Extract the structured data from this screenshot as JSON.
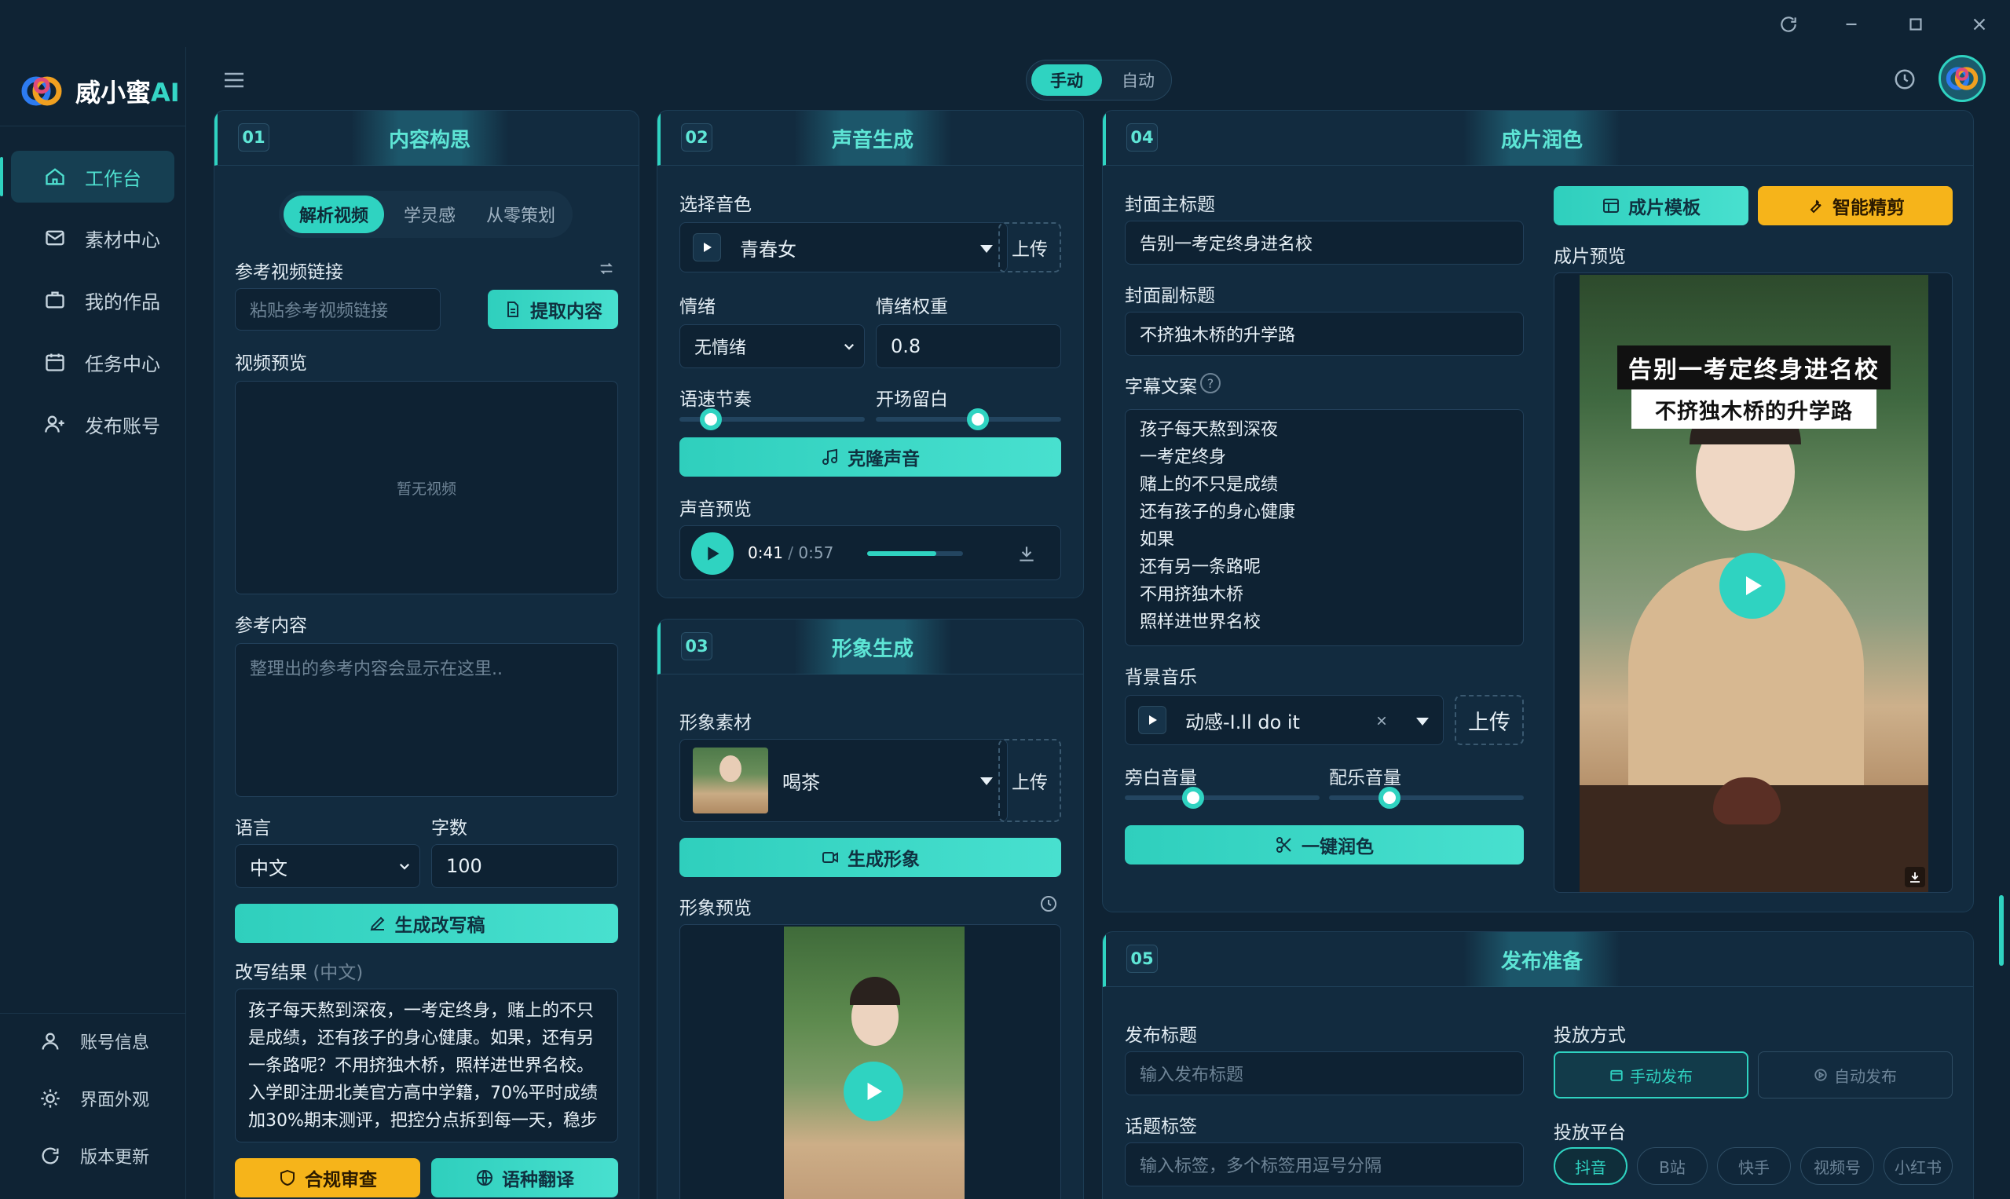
{
  "brand": {
    "name": "威小蜜",
    "suffix": "AI"
  },
  "mode_toggle": {
    "manual": "手动",
    "auto": "自动"
  },
  "sidebar": {
    "items": [
      {
        "label": "工作台",
        "icon": "home-icon"
      },
      {
        "label": "素材中心",
        "icon": "mail-icon"
      },
      {
        "label": "我的作品",
        "icon": "briefcase-icon"
      },
      {
        "label": "任务中心",
        "icon": "calendar-icon"
      },
      {
        "label": "发布账号",
        "icon": "user-plus-icon"
      }
    ],
    "bottom": [
      {
        "label": "账号信息",
        "icon": "user-icon"
      },
      {
        "label": "界面外观",
        "icon": "sun-icon"
      },
      {
        "label": "版本更新",
        "icon": "refresh-icon"
      }
    ]
  },
  "card1": {
    "num": "01",
    "title": "内容构思",
    "tabs": [
      "解析视频",
      "学灵感",
      "从零策划"
    ],
    "ref_link_label": "参考视频链接",
    "ref_link_placeholder": "粘贴参考视频链接",
    "extract_btn": "提取内容",
    "video_preview_label": "视频预览",
    "no_video": "暂无视频",
    "ref_content_label": "参考内容",
    "ref_content_placeholder": "整理出的参考内容会显示在这里..",
    "language_label": "语言",
    "language_value": "中文",
    "words_label": "字数",
    "words_value": "100",
    "rewrite_btn": "生成改写稿",
    "result_label": "改写结果",
    "result_lang": "(中文)",
    "result_text": "孩子每天熬到深夜，一考定终身，赌上的不只是成绩，还有孩子的身心健康。如果，还有另一条路呢？不用挤独木桥，照样进世界名校。入学即注册北美官方高中学籍，70%平时成绩加30%期末测评，把控分点拆到每一天，稳步",
    "compliance_btn": "合规审查",
    "translate_btn": "语种翻译"
  },
  "card2": {
    "num": "02",
    "title": "声音生成",
    "voice_label": "选择音色",
    "voice_value": "青春女",
    "upload": "上传",
    "emotion_label": "情绪",
    "emotion_value": "无情绪",
    "emotion_weight_label": "情绪权重",
    "emotion_weight_value": "0.8",
    "speed_label": "语速节奏",
    "pause_label": "开场留白",
    "speed_level": 0.17,
    "pause_level": 0.55,
    "clone_btn": "克隆声音",
    "audio_preview_label": "声音预览",
    "time_current": "0:41",
    "time_sep": "/",
    "time_total": "0:57",
    "audio_progress": 0.72
  },
  "card3": {
    "num": "03",
    "title": "形象生成",
    "material_label": "形象素材",
    "material_value": "喝茶",
    "upload": "上传",
    "generate_btn": "生成形象",
    "preview_label": "形象预览"
  },
  "card4": {
    "num": "04",
    "title": "成片润色",
    "cover_title_label": "封面主标题",
    "cover_title_value": "告别一考定终身进名校",
    "cover_subtitle_label": "封面副标题",
    "cover_subtitle_value": "不挤独木桥的升学路",
    "subtitle_text_label": "字幕文案",
    "subtitle_lines": [
      "孩子每天熬到深夜",
      "一考定终身",
      "赌上的不只是成绩",
      "还有孩子的身心健康",
      "如果",
      "还有另一条路呢",
      "不用挤独木桥",
      "照样进世界名校"
    ],
    "bgm_label": "背景音乐",
    "bgm_value": "动感-I.ll do it",
    "upload": "上传",
    "narration_volume_label": "旁白音量",
    "music_volume_label": "配乐音量",
    "narration_level": 0.35,
    "music_level": 0.31,
    "polish_btn": "一键润色",
    "template_btn": "成片模板",
    "smart_cut_btn": "智能精剪",
    "final_preview_label": "成片预览",
    "video_title_line1": "告别一考定终身进名校",
    "video_title_line2": "不挤独木桥的升学路"
  },
  "card5": {
    "num": "05",
    "title": "发布准备",
    "publish_title_label": "发布标题",
    "publish_title_placeholder": "输入发布标题",
    "tags_label": "话题标签",
    "tags_placeholder": "输入标签，多个标签用逗号分隔",
    "method_label": "投放方式",
    "manual_publish": "手动发布",
    "auto_publish": "自动发布",
    "platform_label": "投放平台",
    "platforms": [
      "抖音",
      "B站",
      "快手",
      "视频号",
      "小红书"
    ]
  },
  "colors": {
    "accent": "#2fd3c1",
    "warning": "#f6b41a",
    "bg": "#0f2334"
  }
}
